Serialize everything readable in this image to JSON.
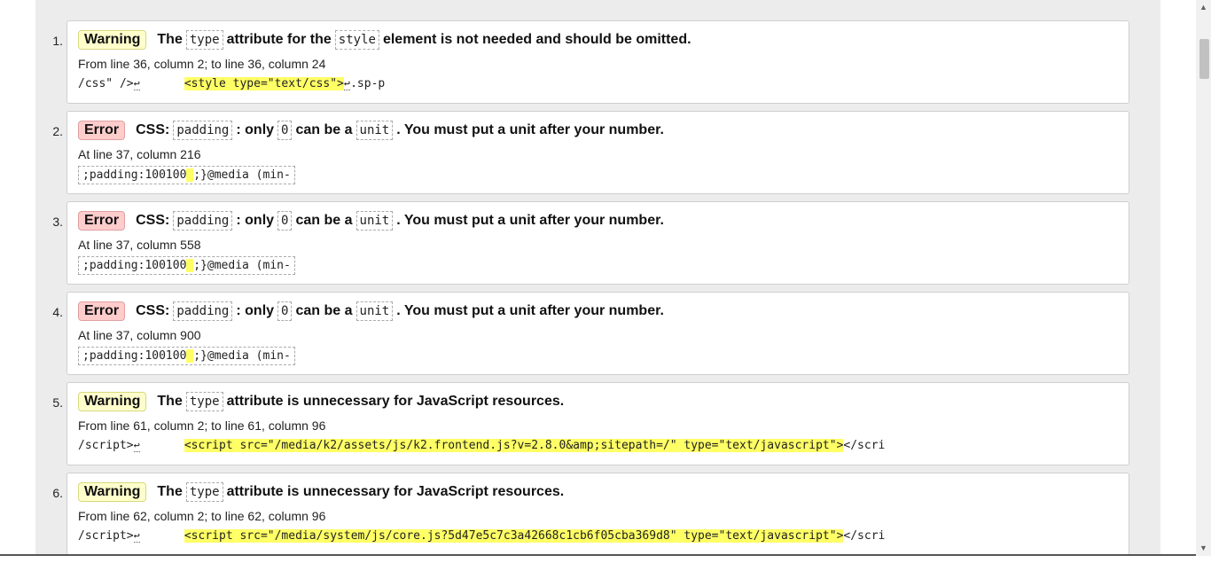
{
  "messages": [
    {
      "num": "1.",
      "type": "warning",
      "badge": "Warning",
      "head": [
        {
          "kind": "text",
          "value": "The"
        },
        {
          "kind": "code",
          "value": "type"
        },
        {
          "kind": "text",
          "value": "attribute for the"
        },
        {
          "kind": "code",
          "value": "style"
        },
        {
          "kind": "text",
          "value": "element is not needed and should be omitted."
        }
      ],
      "location": "From line 36, column 2; to line 36, column 24",
      "extract_boxed": false,
      "extract": {
        "pre": "/css\" />",
        "pre_ret": "↩",
        "hl": "<style type=\"text/css\">",
        "post_ret": "↩",
        "post": ".sp-p"
      }
    },
    {
      "num": "2.",
      "type": "error",
      "badge": "Error",
      "head": [
        {
          "kind": "text",
          "value": "CSS:"
        },
        {
          "kind": "code",
          "value": "padding"
        },
        {
          "kind": "text",
          "value": ": only"
        },
        {
          "kind": "code",
          "value": "0"
        },
        {
          "kind": "text",
          "value": "can be a"
        },
        {
          "kind": "code",
          "value": "unit"
        },
        {
          "kind": "text",
          "value": ". You must put a unit after your number."
        }
      ],
      "location": "At line 37, column 216",
      "extract_boxed": true,
      "extract": {
        "pre": ";padding:100100",
        "pre_ret": "",
        "hl": " ",
        "post_ret": "",
        "post": ";}@media (min-"
      }
    },
    {
      "num": "3.",
      "type": "error",
      "badge": "Error",
      "head": [
        {
          "kind": "text",
          "value": "CSS:"
        },
        {
          "kind": "code",
          "value": "padding"
        },
        {
          "kind": "text",
          "value": ": only"
        },
        {
          "kind": "code",
          "value": "0"
        },
        {
          "kind": "text",
          "value": "can be a"
        },
        {
          "kind": "code",
          "value": "unit"
        },
        {
          "kind": "text",
          "value": ". You must put a unit after your number."
        }
      ],
      "location": "At line 37, column 558",
      "extract_boxed": true,
      "extract": {
        "pre": ";padding:100100",
        "pre_ret": "",
        "hl": " ",
        "post_ret": "",
        "post": ";}@media (min-"
      }
    },
    {
      "num": "4.",
      "type": "error",
      "badge": "Error",
      "head": [
        {
          "kind": "text",
          "value": "CSS:"
        },
        {
          "kind": "code",
          "value": "padding"
        },
        {
          "kind": "text",
          "value": ": only"
        },
        {
          "kind": "code",
          "value": "0"
        },
        {
          "kind": "text",
          "value": "can be a"
        },
        {
          "kind": "code",
          "value": "unit"
        },
        {
          "kind": "text",
          "value": ". You must put a unit after your number."
        }
      ],
      "location": "At line 37, column 900",
      "extract_boxed": true,
      "extract": {
        "pre": ";padding:100100",
        "pre_ret": "",
        "hl": " ",
        "post_ret": "",
        "post": ";}@media (min-"
      }
    },
    {
      "num": "5.",
      "type": "warning",
      "badge": "Warning",
      "head": [
        {
          "kind": "text",
          "value": "The"
        },
        {
          "kind": "code",
          "value": "type"
        },
        {
          "kind": "text",
          "value": "attribute is unnecessary for JavaScript resources."
        }
      ],
      "location": "From line 61, column 2; to line 61, column 96",
      "extract_boxed": false,
      "extract": {
        "pre": "/script>",
        "pre_ret": "↩",
        "hl": "<script src=\"/media/k2/assets/js/k2.frontend.js?v=2.8.0&amp;sitepath=/\" type=\"text/javascript\">",
        "post_ret": "",
        "post": "</scri"
      }
    },
    {
      "num": "6.",
      "type": "warning",
      "badge": "Warning",
      "head": [
        {
          "kind": "text",
          "value": "The"
        },
        {
          "kind": "code",
          "value": "type"
        },
        {
          "kind": "text",
          "value": "attribute is unnecessary for JavaScript resources."
        }
      ],
      "location": "From line 62, column 2; to line 62, column 96",
      "extract_boxed": false,
      "extract": {
        "pre": "/script>",
        "pre_ret": "↩",
        "hl": "<script src=\"/media/system/js/core.js?5d47e5c7c3a42668c1cb6f05cba369d8\" type=\"text/javascript\">",
        "post_ret": "",
        "post": "</scri"
      }
    }
  ],
  "scrollbar": {
    "up_icon": "▲",
    "down_icon": "▼"
  }
}
